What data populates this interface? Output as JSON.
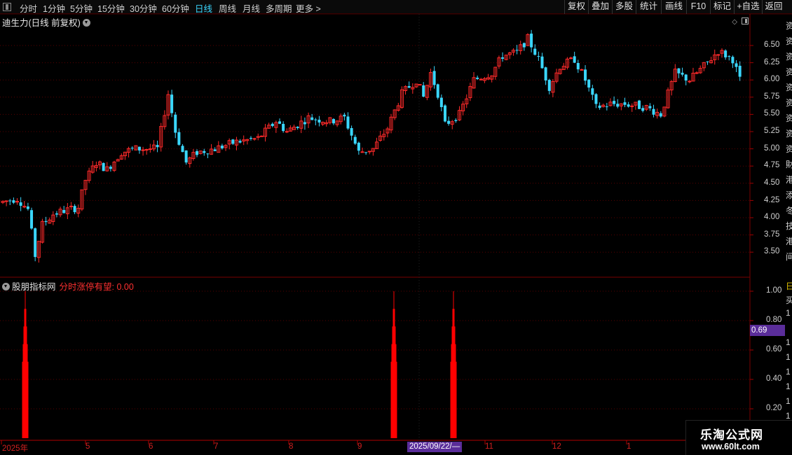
{
  "toolbar": {
    "periods": [
      "分时",
      "1分钟",
      "5分钟",
      "15分钟",
      "30分钟",
      "60分钟",
      "日线",
      "周线",
      "月线",
      "多周期",
      "更多 >"
    ],
    "active_period": "日线",
    "right_buttons": [
      "复权",
      "叠加",
      "多股",
      "统计",
      "画线",
      "F10",
      "标记",
      "+自选",
      "返回"
    ]
  },
  "main_pane": {
    "title": "迪生力(日线 前复权)",
    "y_ticks": [
      "6.50",
      "6.25",
      "6.00",
      "5.75",
      "5.50",
      "5.25",
      "5.00",
      "4.75",
      "4.50",
      "4.25",
      "4.00",
      "3.75",
      "3.50"
    ],
    "side_chars": [
      "资",
      "资",
      "资",
      "资",
      "资",
      "资",
      "资",
      "资",
      "资",
      "財",
      "港",
      "添",
      "冬",
      "技",
      "港",
      "间"
    ]
  },
  "indicator_pane": {
    "name": "股朋指标网",
    "series_label": "分时涨停有望:",
    "series_value": "0.00",
    "y_ticks": [
      "1.00",
      "0.80",
      "0.60",
      "0.40",
      "0.20"
    ],
    "current_value_tag": "0.69",
    "side_chars": [
      "日",
      "买",
      "1",
      "1",
      "1",
      "1",
      "1",
      "1",
      "1",
      "1",
      "1"
    ]
  },
  "x_axis": {
    "labels": [
      "2025年",
      "5",
      "6",
      "7",
      "8",
      "9",
      "11",
      "12",
      "1"
    ],
    "cursor_date": "2025/09/22/—"
  },
  "chart_data": {
    "type": "candlestick",
    "title": "迪生力(日线 前复权)",
    "ylim": [
      3.25,
      6.75
    ],
    "summary": {
      "start_price_approx": 4.2,
      "low_approx": 3.3,
      "high_approx": 6.72,
      "end_price_approx": 6.05
    },
    "indicator": {
      "name": "分时涨停有望",
      "type": "bar",
      "ylim": [
        0,
        1.0
      ],
      "spikes_at_fraction_of_range": [
        0.03,
        0.53,
        0.61
      ],
      "spike_value": 1.0
    },
    "colors": {
      "up": "#ff2a2a",
      "down": "#3ad7ff",
      "grid": "#5a0000",
      "indicator": "#ff0000"
    }
  },
  "watermark": {
    "title": "乐淘公式网",
    "url": "www.60lt.com"
  }
}
